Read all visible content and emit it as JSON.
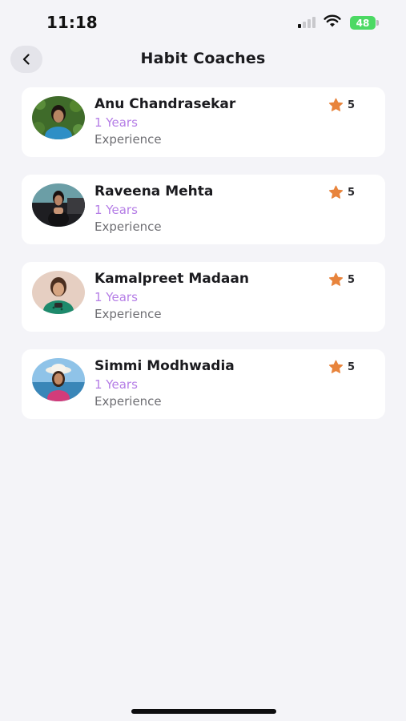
{
  "status_bar": {
    "time": "11:18",
    "battery": "48"
  },
  "header": {
    "title": "Habit Coaches",
    "back_icon": "chevron-left-icon"
  },
  "colors": {
    "accent_purple": "#b57ee6",
    "star_orange": "#e8843c",
    "background": "#f4f4f8",
    "card": "#ffffff"
  },
  "coaches": [
    {
      "name": "Anu Chandrasekar",
      "years": "1 Years",
      "experience_label": "Experience",
      "rating": "5"
    },
    {
      "name": "Raveena Mehta",
      "years": "1 Years",
      "experience_label": "Experience",
      "rating": "5"
    },
    {
      "name": "Kamalpreet Madaan",
      "years": "1 Years",
      "experience_label": "Experience",
      "rating": "5"
    },
    {
      "name": "Simmi Modhwadia",
      "years": "1 Years",
      "experience_label": "Experience",
      "rating": "5"
    }
  ]
}
